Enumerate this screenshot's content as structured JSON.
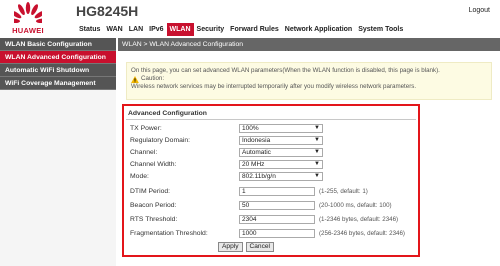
{
  "brand": {
    "logo_text": "HUAWEI",
    "accent": "#c8102e"
  },
  "header": {
    "model": "HG8245H",
    "logout": "Logout"
  },
  "nav": {
    "items": [
      {
        "label": "Status"
      },
      {
        "label": "WAN"
      },
      {
        "label": "LAN"
      },
      {
        "label": "IPv6"
      },
      {
        "label": "WLAN",
        "active": true
      },
      {
        "label": "Security"
      },
      {
        "label": "Forward Rules"
      },
      {
        "label": "Network Application"
      },
      {
        "label": "System Tools"
      }
    ]
  },
  "sidebar": {
    "items": [
      {
        "label": "WLAN Basic Configuration"
      },
      {
        "label": "WLAN Advanced Configuration",
        "active": true
      },
      {
        "label": "Automatic WiFi Shutdown"
      },
      {
        "label": "WiFi Coverage Management"
      }
    ]
  },
  "breadcrumb": "WLAN > WLAN Advanced Configuration",
  "info": {
    "text": "On this page, you can set advanced WLAN parameters(When the WLAN function is disabled, this page is blank).",
    "caution_label": "Caution:",
    "caution_text": "Wireless network services may be interrupted temporarily after you modify wireless network parameters."
  },
  "form": {
    "title": "Advanced Configuration",
    "tx_power": {
      "label": "TX Power:",
      "value": "100%"
    },
    "regulatory_domain": {
      "label": "Regulatory Domain:",
      "value": "Indonesia"
    },
    "channel": {
      "label": "Channel:",
      "value": "Automatic"
    },
    "channel_width": {
      "label": "Channel Width:",
      "value": "20 MHz"
    },
    "mode": {
      "label": "Mode:",
      "value": "802.11b/g/n"
    },
    "dtim_period": {
      "label": "DTIM Period:",
      "value": "1",
      "hint": "(1-255, default: 1)"
    },
    "beacon_period": {
      "label": "Beacon Period:",
      "value": "50",
      "hint": "(20-1000 ms, default: 100)"
    },
    "rts_threshold": {
      "label": "RTS Threshold:",
      "value": "2304",
      "hint": "(1-2346 bytes, default: 2346)"
    },
    "fragmentation_threshold": {
      "label": "Fragmentation Threshold:",
      "value": "1000",
      "hint": "(256-2346 bytes, default: 2346)"
    },
    "apply": "Apply",
    "cancel": "Cancel"
  },
  "icons": {
    "logo": "huawei-logo-icon",
    "caution": "warning-icon",
    "dropdown": "chevron-down-icon"
  },
  "colors": {
    "highlight_frame": "#e3151a",
    "info_bg": "#fdfbe3",
    "sidebar_bg": "#555555"
  }
}
